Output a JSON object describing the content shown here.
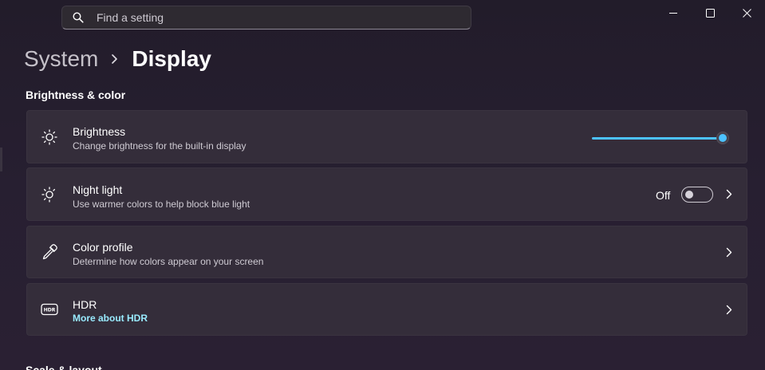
{
  "search": {
    "placeholder": "Find a setting"
  },
  "breadcrumb": {
    "parent": "System",
    "current": "Display"
  },
  "sections": {
    "brightness_color": "Brightness & color",
    "scale_layout": "Scale & layout"
  },
  "cards": {
    "brightness": {
      "title": "Brightness",
      "description": "Change brightness for the built-in display",
      "slider_value_percent": 100
    },
    "night_light": {
      "title": "Night light",
      "description": "Use warmer colors to help block blue light",
      "state_label": "Off",
      "enabled": false
    },
    "color_profile": {
      "title": "Color profile",
      "description": "Determine how colors appear on your screen"
    },
    "hdr": {
      "title": "HDR",
      "link": "More about HDR"
    }
  },
  "icons": {
    "search": "search-icon",
    "brightness": "sun-icon",
    "night_light": "night-light-icon",
    "color_profile": "eyedropper-icon",
    "hdr": "hdr-icon",
    "chevron": "chevron-right-icon"
  },
  "colors": {
    "accent": "#4cc2ff",
    "link": "#99ebff",
    "card_bg": "#342d3a"
  }
}
